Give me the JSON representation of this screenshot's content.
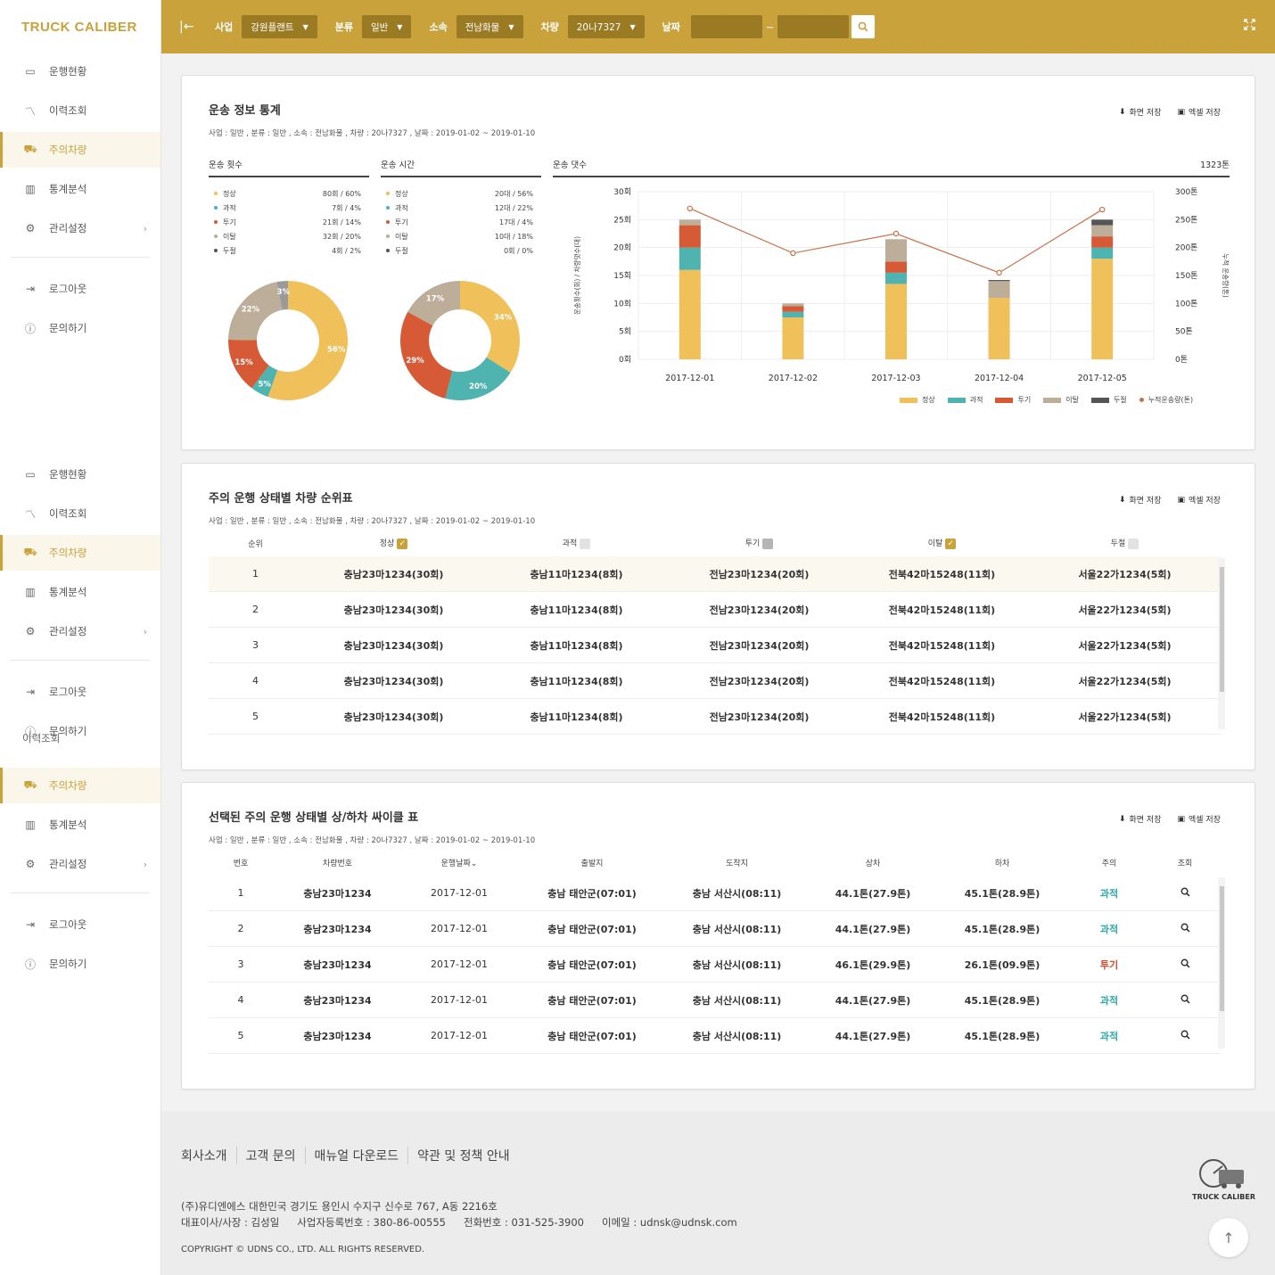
{
  "app": {
    "logo": "TRUCK CALIBER"
  },
  "sidebar": {
    "groups": [
      {
        "items": [
          {
            "label": "운행현황",
            "icon": "monitor-icon"
          },
          {
            "label": "이력조회",
            "icon": "line-chart-icon"
          },
          {
            "label": "주의차량",
            "icon": "truck-icon",
            "active": true
          },
          {
            "label": "통계분석",
            "icon": "bar-chart-icon"
          },
          {
            "label": "관리설정",
            "icon": "gear-icon",
            "arrow": "›"
          }
        ],
        "extra": [
          {
            "label": "로그아웃",
            "icon": "logout-icon"
          },
          {
            "label": "문의하기",
            "icon": "info-icon"
          }
        ]
      }
    ],
    "partial_label": "이력조회"
  },
  "topbar": {
    "collapse_icon": "|←",
    "filters": [
      {
        "label": "사업",
        "value": "강원플랜트"
      },
      {
        "label": "분류",
        "value": "일반"
      },
      {
        "label": "소속",
        "value": "전남화물"
      },
      {
        "label": "차량",
        "value": "20나7327"
      }
    ],
    "date_label": "날짜",
    "date_sep": "~"
  },
  "actions": {
    "save_screen": "화면 저장",
    "save_excel": "엑셀 저장"
  },
  "card1": {
    "title": "운송 정보 통계",
    "subtitle": "사업 : 일반 , 분류 : 일반 , 소속 : 전남화물 , 차량 : 20나7327 , 날짜 : 2019-01-02 ~ 2019-01-10",
    "count_title": "운송 횟수",
    "time_title": "운송 시간",
    "tonnage_title": "운송 댓수",
    "tonnage_total": "1323톤",
    "count_legend": [
      {
        "label": "정상",
        "value": "80회 / 60%",
        "color": "#f0c05a"
      },
      {
        "label": "과적",
        "value": "7회 / 4%",
        "color": "#4fb3b0"
      },
      {
        "label": "투기",
        "value": "21회 / 14%",
        "color": "#d55a35"
      },
      {
        "label": "이탈",
        "value": "32회 / 20%",
        "color": "#bcae98"
      },
      {
        "label": "두절",
        "value": "4회 / 2%",
        "color": "#555555"
      }
    ],
    "time_legend": [
      {
        "label": "정상",
        "value": "20대 / 56%",
        "color": "#f0c05a"
      },
      {
        "label": "과적",
        "value": "12대 / 22%",
        "color": "#4fb3b0"
      },
      {
        "label": "투기",
        "value": "17대 / 4%",
        "color": "#d55a35"
      },
      {
        "label": "이탈",
        "value": "10대 / 18%",
        "color": "#bcae98"
      },
      {
        "label": "두절",
        "value": "0회 / 0%",
        "color": "#555555"
      }
    ]
  },
  "chart_data": [
    {
      "type": "pie",
      "title": "운송 횟수",
      "labels": [
        "정상",
        "과적",
        "투기",
        "이탈",
        "두절"
      ],
      "values": [
        56,
        5,
        15,
        22,
        3
      ],
      "value_labels": [
        "56%",
        "5%",
        "15%",
        "22%",
        "3%"
      ],
      "colors": [
        "#f0c05a",
        "#4fb3b0",
        "#d55a35",
        "#bcae98",
        "#9a9a9a"
      ]
    },
    {
      "type": "pie",
      "title": "운송 시간",
      "labels": [
        "정상",
        "과적",
        "투기",
        "이탈"
      ],
      "values": [
        34,
        20,
        29,
        17
      ],
      "value_labels": [
        "34%",
        "20%",
        "29%",
        "17%"
      ],
      "colors": [
        "#f0c05a",
        "#4fb3b0",
        "#d55a35",
        "#bcae98"
      ]
    },
    {
      "type": "bar",
      "stacked": true,
      "title": "운송 댓수",
      "categories": [
        "2017-12-01",
        "2017-12-02",
        "2017-12-03",
        "2017-12-04",
        "2017-12-05"
      ],
      "series": [
        {
          "name": "정상",
          "values": [
            16,
            7.5,
            13.5,
            11,
            18
          ],
          "color": "#f0c05a"
        },
        {
          "name": "과적",
          "values": [
            4,
            1,
            2,
            0,
            2
          ],
          "color": "#4fb3b0"
        },
        {
          "name": "투기",
          "values": [
            4,
            1,
            2,
            0,
            2
          ],
          "color": "#d55a35"
        },
        {
          "name": "이탈",
          "values": [
            1,
            0.5,
            4,
            3,
            2
          ],
          "color": "#bcae98"
        },
        {
          "name": "두절",
          "values": [
            0,
            0,
            0,
            0.2,
            1
          ],
          "color": "#555555"
        }
      ],
      "line": {
        "name": "누적운송량(톤)",
        "values": [
          270,
          190,
          225,
          155,
          268
        ],
        "color": "#c9724a"
      },
      "ylim": [
        0,
        30
      ],
      "yticks": [
        "30회",
        "25회",
        "20회",
        "15회",
        "10회",
        "5회",
        "0회"
      ],
      "y2lim": [
        0,
        300
      ],
      "y2ticks": [
        "300톤",
        "250톤",
        "200톤",
        "150톤",
        "100톤",
        "50톤",
        "0톤"
      ],
      "ylabel": "운송횟수(회) / 차량댓수(대)",
      "y2label": "누적 운송량(톤)"
    }
  ],
  "card2": {
    "title": "주의 운행 상태별 차량 순위표",
    "subtitle": "사업 : 일반 , 분류 : 일반 , 소속 : 전남화물 , 차량 : 20나7327 , 날짜 : 2019-01-02 ~ 2019-01-10",
    "headers": [
      {
        "label": "순위",
        "check": ""
      },
      {
        "label": "정상",
        "check": "on"
      },
      {
        "label": "과적",
        "check": "off"
      },
      {
        "label": "투기",
        "check": "grey"
      },
      {
        "label": "이탈",
        "check": "on"
      },
      {
        "label": "두절",
        "check": "off"
      }
    ],
    "rows": [
      [
        "1",
        "충남23마1234(30회)",
        "충남11마1234(8회)",
        "전남23마1234(20회)",
        "전북42마15248(11회)",
        "서울22가1234(5회)"
      ],
      [
        "2",
        "충남23마1234(30회)",
        "충남11마1234(8회)",
        "전남23마1234(20회)",
        "전북42마15248(11회)",
        "서울22가1234(5회)"
      ],
      [
        "3",
        "충남23마1234(30회)",
        "충남11마1234(8회)",
        "전남23마1234(20회)",
        "전북42마15248(11회)",
        "서울22가1234(5회)"
      ],
      [
        "4",
        "충남23마1234(30회)",
        "충남11마1234(8회)",
        "전남23마1234(20회)",
        "전북42마15248(11회)",
        "서울22가1234(5회)"
      ],
      [
        "5",
        "충남23마1234(30회)",
        "충남11마1234(8회)",
        "전남23마1234(20회)",
        "전북42마15248(11회)",
        "서울22가1234(5회)"
      ]
    ]
  },
  "card3": {
    "title": "선택된 주의 운행 상태별 상/하차 싸이클 표",
    "subtitle": "사업 : 일반 , 분류 : 일반 , 소속 : 전남화물 , 차량 : 20나7327 , 날짜 : 2019-01-02 ~ 2019-01-10",
    "headers": [
      "번호",
      "차량번호",
      "운행날짜",
      "출발지",
      "도착지",
      "상차",
      "하차",
      "주의",
      "조회"
    ],
    "sort_mark": "⌄",
    "rows": [
      [
        "1",
        "충남23마1234",
        "2017-12-01",
        "충남 태안군(07:01)",
        "충남 서산시(08:11)",
        "44.1톤(27.9톤)",
        "45.1톤(28.9톤)",
        "과적"
      ],
      [
        "2",
        "충남23마1234",
        "2017-12-01",
        "충남 태안군(07:01)",
        "충남 서산시(08:11)",
        "44.1톤(27.9톤)",
        "45.1톤(28.9톤)",
        "과적"
      ],
      [
        "3",
        "충남23마1234",
        "2017-12-01",
        "충남 태안군(07:01)",
        "충남 서산시(08:11)",
        "46.1톤(29.9톤)",
        "26.1톤(09.9톤)",
        "투기"
      ],
      [
        "4",
        "충남23마1234",
        "2017-12-01",
        "충남 태안군(07:01)",
        "충남 서산시(08:11)",
        "44.1톤(27.9톤)",
        "45.1톤(28.9톤)",
        "과적"
      ],
      [
        "5",
        "충남23마1234",
        "2017-12-01",
        "충남 태안군(07:01)",
        "충남 서산시(08:11)",
        "44.1톤(27.9톤)",
        "45.1톤(28.9톤)",
        "과적"
      ]
    ],
    "status_colors": {
      "과적": "#2fa8a5",
      "투기": "#d24a2a"
    }
  },
  "footer": {
    "links": [
      "회사소개",
      "고객 문의",
      "매뉴얼 다운로드",
      "약관 및 정책 안내"
    ],
    "address": "(주)유디엔에스 대한민국 경기도 용인시 수지구 신수로 767, A동 2216호",
    "ceo": "대표이사/사장 : 김성일",
    "biz_no": "사업자등록번호 : 380-86-00555",
    "phone": "전화번호 : 031-525-3900",
    "email": "이메일 : udnsk@udnsk.com",
    "copyright": "COPYRIGHT © UDNS CO., LTD. ALL RIGHTS RESERVED.",
    "logo": "TRUCK CALIBER"
  }
}
